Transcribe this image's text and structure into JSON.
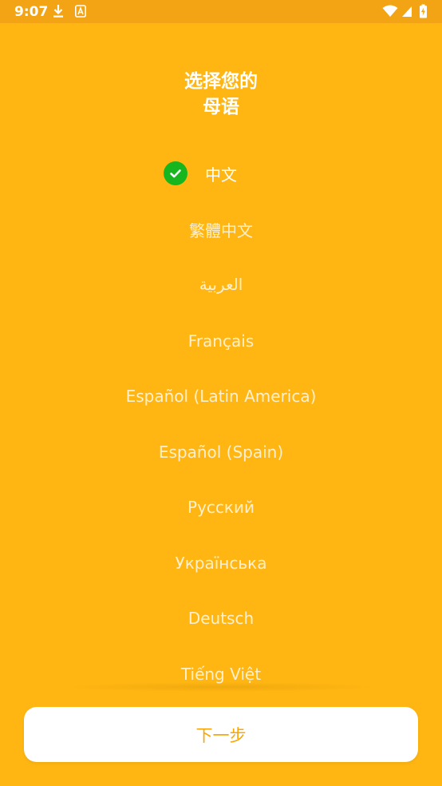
{
  "status_bar": {
    "time": "9:07",
    "icons_left": [
      "download-icon",
      "font-a-icon"
    ],
    "icons_right": [
      "wifi-icon",
      "signal-icon",
      "battery-charging-icon"
    ]
  },
  "title": {
    "line1": "选择您的",
    "line2": "母语"
  },
  "languages": [
    {
      "label": "中文",
      "selected": true
    },
    {
      "label": "繁體中文",
      "selected": false
    },
    {
      "label": "العربية",
      "selected": false
    },
    {
      "label": "Français",
      "selected": false
    },
    {
      "label": "Español (Latin America)",
      "selected": false
    },
    {
      "label": "Español (Spain)",
      "selected": false
    },
    {
      "label": "Русский",
      "selected": false
    },
    {
      "label": "Українська",
      "selected": false
    },
    {
      "label": "Deutsch",
      "selected": false
    },
    {
      "label": "Tiếng Việt",
      "selected": false
    }
  ],
  "next_button": {
    "label": "下一步"
  },
  "colors": {
    "background": "#FFB612",
    "status_bar": "#F2A414",
    "check": "#18B61E",
    "button_text": "#F7A707"
  }
}
